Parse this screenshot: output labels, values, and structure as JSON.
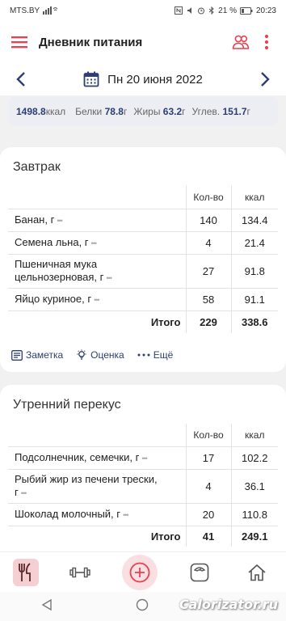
{
  "statusbar": {
    "carrier": "MTS.BY",
    "battery": "21 %",
    "time": "20:23"
  },
  "header": {
    "title": "Дневник питания"
  },
  "date": {
    "label": "Пн 20 июня 2022"
  },
  "summary": {
    "kcal_value": "1498.8",
    "kcal_unit": "ккал",
    "protein_label": "Белки",
    "protein_value": "78.8",
    "protein_unit": "г",
    "fat_label": "Жиры",
    "fat_value": "63.2",
    "fat_unit": "г",
    "carbs_label": "Углев.",
    "carbs_value": "151.7",
    "carbs_unit": "г"
  },
  "table_headers": {
    "qty": "Кол-во",
    "kcal": "ккал"
  },
  "breakfast": {
    "title": "Завтрак",
    "rows": [
      {
        "name": "Банан, г",
        "qty": "140",
        "kcal": "134.4"
      },
      {
        "name": "Семена льна, г",
        "qty": "4",
        "kcal": "21.4"
      },
      {
        "name": "Пшеничная мука цельнозерновая, г",
        "qty": "27",
        "kcal": "91.8"
      },
      {
        "name": "Яйцо куриное, г",
        "qty": "58",
        "kcal": "91.1"
      }
    ],
    "total_label": "Итого",
    "total_qty": "229",
    "total_kcal": "338.6"
  },
  "actions": {
    "note": "Заметка",
    "rating": "Оценка",
    "more": "Ещё"
  },
  "snack": {
    "title": "Утренний перекус",
    "rows": [
      {
        "name": "Подсолнечник, семечки, г",
        "qty": "17",
        "kcal": "102.2"
      },
      {
        "name": "Рыбий жир из печени трески, г",
        "qty": "4",
        "kcal": "36.1"
      },
      {
        "name": "Шоколад молочный, г",
        "qty": "20",
        "kcal": "110.8"
      }
    ],
    "total_label": "Итого",
    "total_qty": "41",
    "total_kcal": "249.1"
  },
  "watermark": "Calorizator.ru",
  "colors": {
    "accent": "#e8414f",
    "navy": "#2c3e73"
  }
}
